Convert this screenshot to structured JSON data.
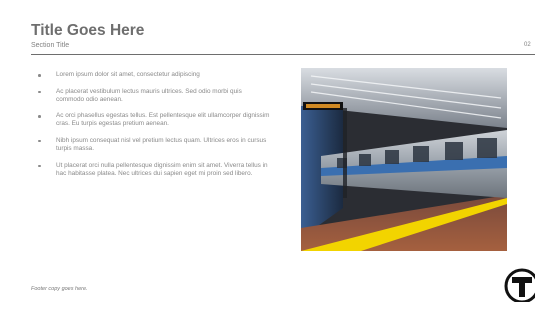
{
  "slide": {
    "title": "Title Goes Here",
    "section_title": "Section Title",
    "page_number": "02",
    "bullets": [
      "Lorem ipsum dolor sit amet, consectetur adipiscing",
      "Ac placerat vestibulum lectus mauris ultrices. Sed odio morbi quis commodo odio aenean.",
      "Ac orci phasellus egestas tellus. Est pellentesque elit ullamcorper dignissim cras. Eu turpis egestas pretium aenean.",
      "Nibh ipsum consequat nisl vel pretium lectus quam. Ultrices eros in cursus turpis massa.",
      "Ut placerat orci nulla pellentesque dignissim enim sit amet. Viverra tellus in hac habitasse platea. Nec ultrices dui sapien eget mi proin sed libero."
    ],
    "footer": "Footer copy goes here.",
    "logo_letter": "T"
  },
  "colors": {
    "title": "#6e6e6e",
    "body_text": "#8a8a8a",
    "rule": "#6e6e6e",
    "train_blue": "#3a6fb0",
    "platform_stripe": "#f2d400"
  },
  "image": {
    "subject": "subway-train-at-platform"
  }
}
